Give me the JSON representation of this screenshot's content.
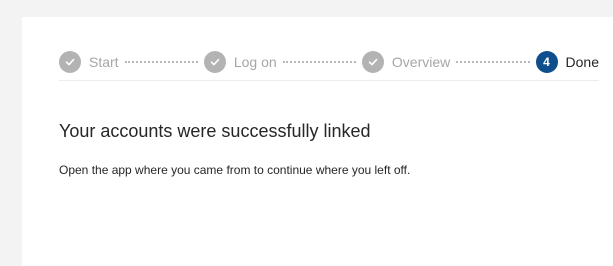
{
  "stepper": {
    "steps": [
      {
        "label": "Start",
        "state": "completed",
        "icon": "check-icon"
      },
      {
        "label": "Log on",
        "state": "completed",
        "icon": "check-icon"
      },
      {
        "label": "Overview",
        "state": "completed",
        "icon": "check-icon"
      },
      {
        "label": "Done",
        "state": "current",
        "number": "4"
      }
    ]
  },
  "content": {
    "heading": "Your accounts were successfully linked",
    "message": "Open the app where you came from to continue where you left off."
  },
  "colors": {
    "page_background": "#f3f3f3",
    "card_background": "#ffffff",
    "completed_step": "#b3b3b3",
    "current_step": "#0f4e8c",
    "muted_text": "#a6a6a6",
    "primary_text": "#262626"
  }
}
